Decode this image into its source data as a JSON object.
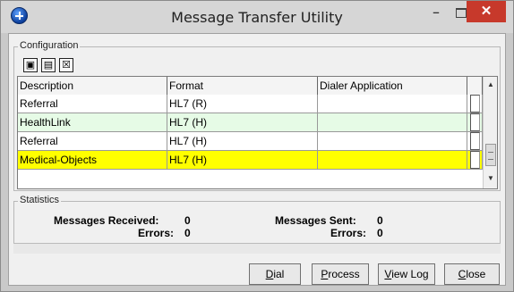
{
  "window": {
    "title": "Message Transfer Utility"
  },
  "titlebar_buttons": {
    "minimize": "–",
    "close": "✕"
  },
  "configuration": {
    "label": "Configuration",
    "toolbar": [
      {
        "name": "new-icon",
        "glyph": "▣"
      },
      {
        "name": "copy-icon",
        "glyph": "▤"
      },
      {
        "name": "delete-icon",
        "glyph": "☒"
      }
    ],
    "columns": [
      "Description",
      "Format",
      "Dialer Application"
    ],
    "rows": [
      {
        "description": "Referral",
        "format": "HL7 (R)",
        "dialer": "",
        "checked": false,
        "bg": "#ffffff"
      },
      {
        "description": "HealthLink",
        "format": "HL7 (H)",
        "dialer": "",
        "checked": false,
        "bg": "#e6fbe6"
      },
      {
        "description": "Referral",
        "format": "HL7 (H)",
        "dialer": "",
        "checked": false,
        "bg": "#ffffff"
      },
      {
        "description": "Medical-Objects",
        "format": "HL7 (H)",
        "dialer": "",
        "checked": false,
        "bg": "#ffff00"
      }
    ]
  },
  "statistics": {
    "label": "Statistics",
    "messages_received_label": "Messages Received:",
    "messages_received": "0",
    "errors_label_left": "Errors:",
    "errors_left": "0",
    "messages_sent_label": "Messages Sent:",
    "messages_sent": "0",
    "errors_label_right": "Errors:",
    "errors_right": "0"
  },
  "buttons": {
    "dial": {
      "underline": "D",
      "rest": "ial"
    },
    "process": {
      "underline": "P",
      "rest": "rocess"
    },
    "view_log": {
      "underline": "V",
      "rest": "iew Log"
    },
    "close": {
      "underline": "C",
      "rest": "lose"
    }
  },
  "colors": {
    "close_button": "#c7392b",
    "highlight_row": "#ffff00",
    "alt_row": "#e6fbe6"
  }
}
